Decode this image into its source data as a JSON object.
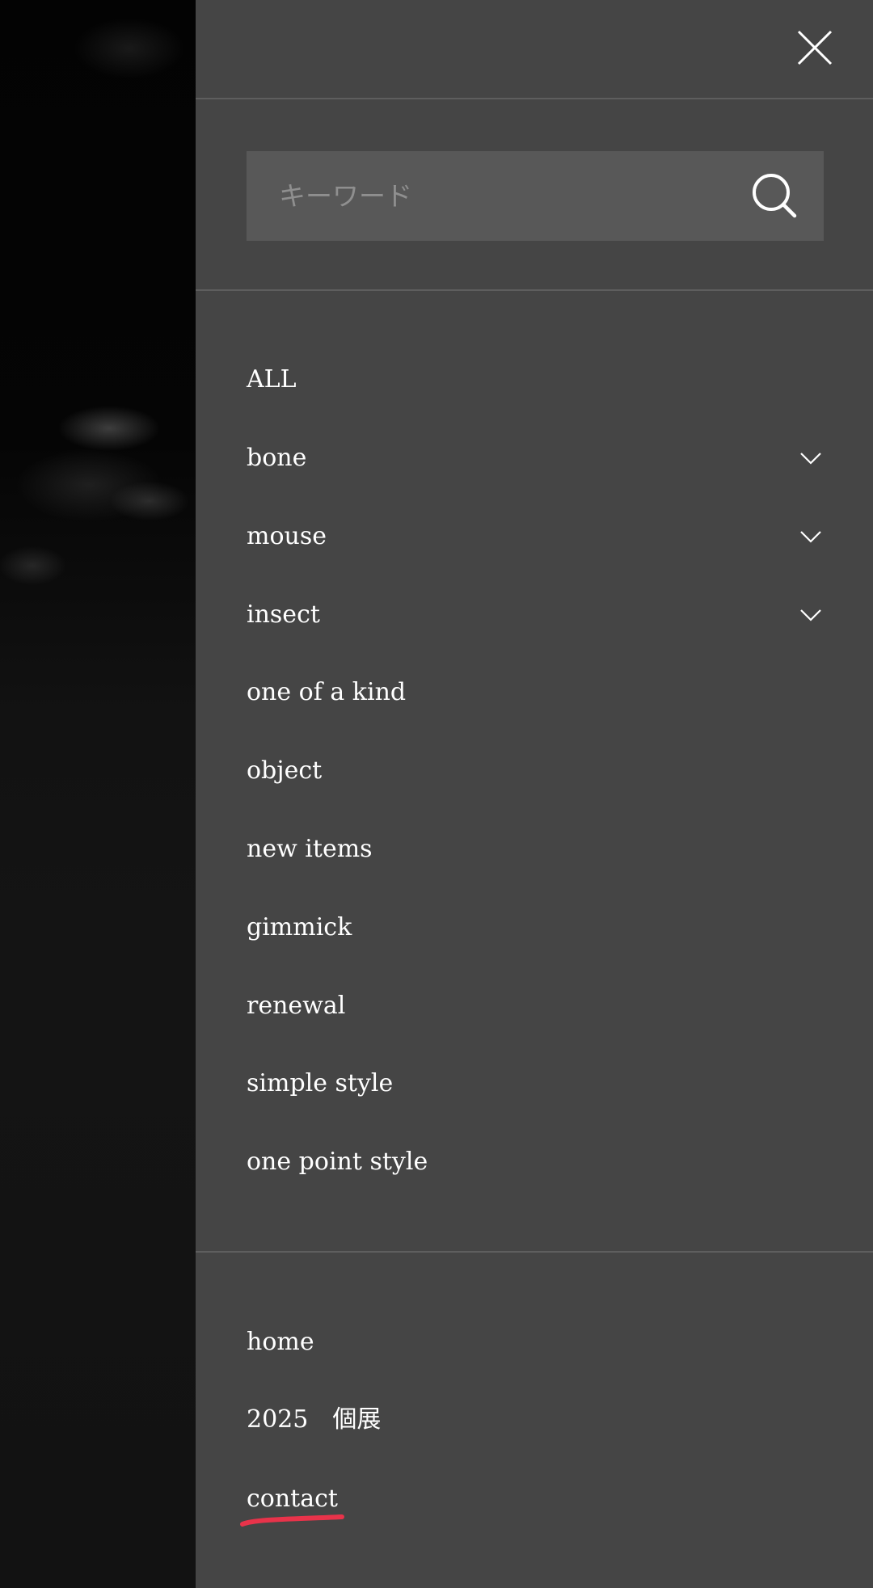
{
  "search": {
    "placeholder": "キーワード"
  },
  "categories": [
    {
      "label": "ALL",
      "has_submenu": false
    },
    {
      "label": "bone",
      "has_submenu": true
    },
    {
      "label": "mouse",
      "has_submenu": true
    },
    {
      "label": "insect",
      "has_submenu": true
    },
    {
      "label": "one of a kind",
      "has_submenu": false
    },
    {
      "label": "object",
      "has_submenu": false
    },
    {
      "label": "new items",
      "has_submenu": false
    },
    {
      "label": "gimmick",
      "has_submenu": false
    },
    {
      "label": "renewal",
      "has_submenu": false
    },
    {
      "label": "simple style",
      "has_submenu": false
    },
    {
      "label": "one point style",
      "has_submenu": false
    }
  ],
  "pages": [
    {
      "label": "home"
    },
    {
      "label": "2025　個展"
    },
    {
      "label": "contact"
    }
  ],
  "icons": {
    "close": "close-icon",
    "search": "search-icon",
    "expand": "chevron-down-icon"
  },
  "colors": {
    "drawer_background": "#454545",
    "search_background": "#585858",
    "text": "#ffffff",
    "highlight_mark": "#e8334a"
  }
}
